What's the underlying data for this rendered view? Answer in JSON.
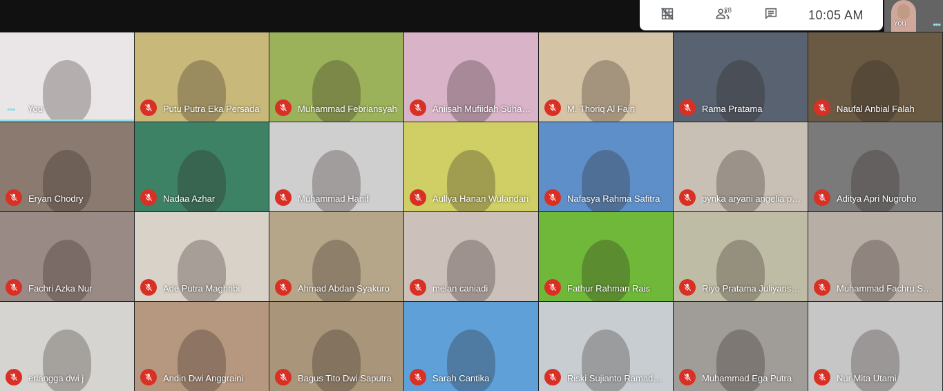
{
  "meeting": {
    "participant_count": "28",
    "clock": "10:05  AM"
  },
  "self_view": {
    "label": "You"
  },
  "icons": {
    "layout": "grid-off-icon",
    "people": "people-icon",
    "chat": "chat-icon",
    "mic_off": "mic-off-icon",
    "more": "more-dots-icon"
  },
  "colors": {
    "panel": "#ffffff",
    "mute_badge": "#d93025",
    "active_indicator": "#8ee0e6"
  },
  "participants": [
    {
      "name": "You",
      "muted": false,
      "self": true,
      "bg": "#eae6e8"
    },
    {
      "name": "Putu Putra Eka Persada",
      "muted": true,
      "bg": "#c8b87a"
    },
    {
      "name": "Muhammad Febriansyah",
      "muted": true,
      "bg": "#9cb25a"
    },
    {
      "name": "Aniisah Mufiidah Suhaimi",
      "muted": true,
      "bg": "#d9b3c8"
    },
    {
      "name": "M. Thoriq Al Fajri",
      "muted": true,
      "bg": "#d5c3a6"
    },
    {
      "name": "Rama Pratama",
      "muted": true,
      "bg": "#586270"
    },
    {
      "name": "Naufal Anbial Falah",
      "muted": true,
      "bg": "#6a5a44"
    },
    {
      "name": "Eryan Chodry",
      "muted": true,
      "bg": "#8a7a70"
    },
    {
      "name": "Nadaa Azhar",
      "muted": true,
      "bg": "#3e8266"
    },
    {
      "name": "Muhammad Hanif",
      "muted": true,
      "bg": "#cfcfcf"
    },
    {
      "name": "Aullya Hanan Wulandari",
      "muted": true,
      "bg": "#cfcf66"
    },
    {
      "name": "Nafasya Rahma Safitra",
      "muted": true,
      "bg": "#5f8fc8"
    },
    {
      "name": "pynka aryani angelia putri",
      "muted": true,
      "bg": "#c8c0b5"
    },
    {
      "name": "Aditya Apri Nugroho",
      "muted": true,
      "bg": "#7a7a7a"
    },
    {
      "name": "Fachri Azka Nur",
      "muted": true,
      "bg": "#9a8a86"
    },
    {
      "name": "Ade Putra Maghribi",
      "muted": true,
      "bg": "#d8d2c8"
    },
    {
      "name": "Ahmad Abdan Syakuro",
      "muted": true,
      "bg": "#b5a68a"
    },
    {
      "name": "melan caniadi",
      "muted": true,
      "bg": "#ccc0bb"
    },
    {
      "name": "Fathur Rahman Rais",
      "muted": true,
      "bg": "#70b83a"
    },
    {
      "name": "Riyo Pratama Juliyansyah",
      "muted": true,
      "bg": "#bfbca5"
    },
    {
      "name": "Muhammad Fachru Syahputra",
      "muted": true,
      "bg": "#b7aea6"
    },
    {
      "name": "erlangga dwi j",
      "muted": true,
      "bg": "#d6d4d0"
    },
    {
      "name": "Andin Dwi Anggraini",
      "muted": true,
      "bg": "#b69780"
    },
    {
      "name": "Bagus Tito Dwi Saputra",
      "muted": true,
      "bg": "#a8957a"
    },
    {
      "name": "Sarah Cantika",
      "muted": true,
      "bg": "#5fa0d8"
    },
    {
      "name": "Riski Sujianto Ramadhan",
      "muted": true,
      "bg": "#c7cdd0"
    },
    {
      "name": "Muhammad Ega Putra",
      "muted": true,
      "bg": "#a09c98"
    },
    {
      "name": "Nur Mita Utami",
      "muted": true,
      "bg": "#c6c6c6"
    }
  ]
}
